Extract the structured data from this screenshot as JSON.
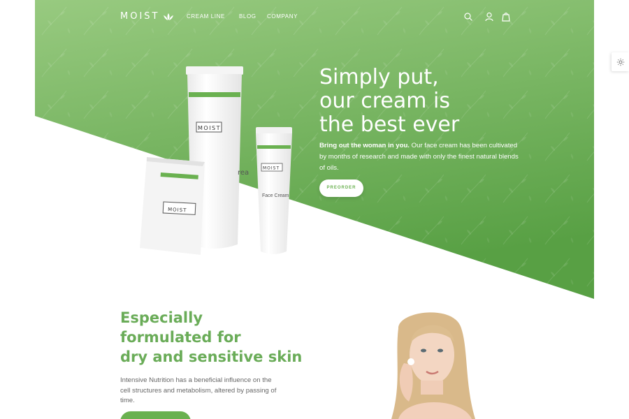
{
  "brand": {
    "logo_text": "MOIST"
  },
  "nav": {
    "links": [
      "CREAM LINE",
      "BLOG",
      "COMPANY"
    ],
    "icons": [
      "search-icon",
      "user-icon",
      "cart-icon"
    ]
  },
  "hero": {
    "title_lines": [
      "Simply put,",
      "our cream is",
      "the best ever"
    ],
    "text_bold": "Bring out the woman in you.",
    "text_rest": " Our face cream has been cultivated by months of research and made with only the finest natural blends of oils.",
    "cta_label": "PREORDER"
  },
  "products": {
    "tube_label": "MOIST",
    "small_tube_label": "MOIST",
    "small_tube_name": "Face Cream",
    "sachet_label": "MOIST",
    "tube_partial_text": "rea"
  },
  "section": {
    "title_lines": [
      "Especially",
      "formulated for",
      "dry and sensitive skin"
    ],
    "text": "Intensive Nutrition has a beneficial influence on the cell structures and metabolism, altered by passing of time."
  },
  "colors": {
    "accent": "#6ab150",
    "hero_top": "#96c97e",
    "hero_bottom": "#57a043",
    "heading_green": "#6aac58"
  },
  "settings_icon": "gear-icon"
}
